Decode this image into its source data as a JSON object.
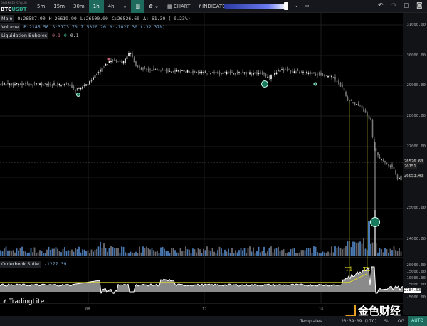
{
  "toolbar": {
    "exchange": "BINANCE USDⓈ-M",
    "base": "BTC",
    "quote": "USDT",
    "intervals": [
      "5m",
      "15m",
      "30m",
      "1h",
      "4h"
    ],
    "active_interval": "1h",
    "chart_label": "CHART",
    "indicators_label": "INDICATORS"
  },
  "legend": {
    "main": {
      "label": "Main",
      "o": "O:26587.90",
      "h": "H:26619.90",
      "l": "L:26500.00",
      "c": "C:26526.60",
      "d": "Δ:-61.30 (-0.23%)"
    },
    "volume": {
      "label": "Volume",
      "b": "B:2146.50",
      "s": "S:3173.70",
      "t": "Σ:5320.20",
      "d": "Δ:-1027.30 (-32.37%)"
    },
    "liq": {
      "label": "Liquidation Bubbles",
      "v1": "0.1",
      "v2": "0",
      "v3": "0.1"
    },
    "orderbook": {
      "label": "Orderbook Suite",
      "value": "-1277.39"
    }
  },
  "price_axis": [
    "31000.00",
    "30000.00",
    "29000.00",
    "28000.00",
    "27000.00",
    "25000.00",
    "24000.00"
  ],
  "price_last": "26526.60",
  "countdown": "20151",
  "price_marker": "26053.40",
  "ob_axis": [
    "20000.00",
    "15000.00",
    "10000.00",
    "5000.00",
    "-5000.00"
  ],
  "ob_marker": "2784.93",
  "annotations": [
    "T1",
    "T2"
  ],
  "time_axis": [
    "08",
    "12",
    "16"
  ],
  "logo": "TradingLite",
  "watermark": "金色财经",
  "bottom": {
    "templates": "Templates",
    "clock": "23:39:09 (UTC)",
    "percent": "%",
    "log": "LOG",
    "auto": "AUTO"
  },
  "colors": {
    "accent": "#1e6a5c",
    "volume": "#4a7bb5",
    "liquidation": "#1a7a5e",
    "annotation": "#e8e020",
    "ob_fill": "#8a8a8a"
  }
}
